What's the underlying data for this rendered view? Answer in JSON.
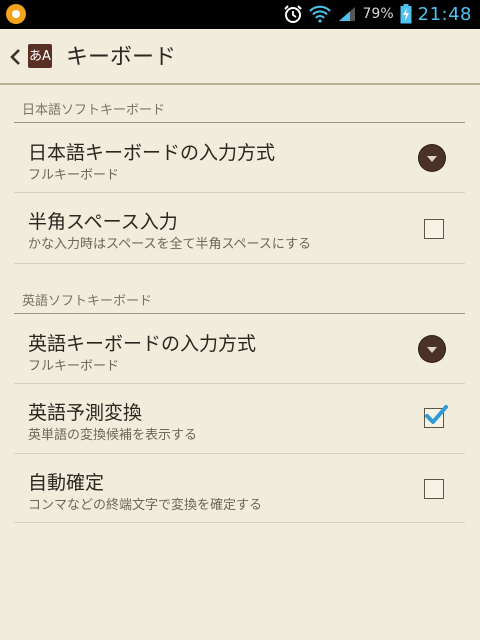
{
  "status_bar": {
    "battery_percent": "79%",
    "time": "21:48",
    "icons": [
      "notification-icon",
      "alarm-icon",
      "wifi-icon",
      "signal-icon",
      "battery-charging-icon"
    ]
  },
  "header": {
    "title": "キーボード",
    "app_icon_text": "あA"
  },
  "sections": [
    {
      "label": "日本語ソフトキーボード",
      "items": [
        {
          "title": "日本語キーボードの入力方式",
          "subtitle": "フルキーボード",
          "control": "dropdown"
        },
        {
          "title": "半角スペース入力",
          "subtitle": "かな入力時はスペースを全て半角スペースにする",
          "control": "checkbox",
          "checked": false
        }
      ]
    },
    {
      "label": "英語ソフトキーボード",
      "items": [
        {
          "title": "英語キーボードの入力方式",
          "subtitle": "フルキーボード",
          "control": "dropdown"
        },
        {
          "title": "英語予測変換",
          "subtitle": "英単語の変換候補を表示する",
          "control": "checkbox",
          "checked": true
        },
        {
          "title": "自動確定",
          "subtitle": "コンマなどの終端文字で変換を確定する",
          "control": "checkbox",
          "checked": false
        }
      ]
    }
  ],
  "colors": {
    "background": "#f1ecdc",
    "status_bar": "#000000",
    "clock": "#4ec1ee",
    "check_accent": "#2f9ad6",
    "dropdown_button": "#4a3129"
  }
}
